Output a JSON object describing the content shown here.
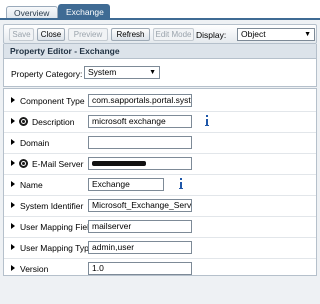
{
  "tabs": [
    {
      "label": "Overview",
      "active": false
    },
    {
      "label": "Exchange",
      "active": true
    }
  ],
  "toolbar": {
    "save_label": "Save",
    "close_label": "Close",
    "preview_label": "Preview",
    "refresh_label": "Refresh",
    "edit_mode_label": "Edit Mode",
    "display_label": "Display:",
    "display_value": "Object"
  },
  "editor": {
    "title": "Property Editor - Exchange",
    "category_label": "Property Category:",
    "category_value": "System"
  },
  "properties": [
    {
      "label": "Component Type",
      "value": "com.sapportals.portal.system",
      "globe": false,
      "info": false
    },
    {
      "label": "Description",
      "value": "microsoft exchange",
      "globe": true,
      "info": true
    },
    {
      "label": "Domain",
      "value": "",
      "globe": false,
      "info": false
    },
    {
      "label": "E-Mail Server",
      "value": "",
      "globe": true,
      "info": false,
      "redacted": true
    },
    {
      "label": "Name",
      "value": "Exchange",
      "globe": false,
      "info": true
    },
    {
      "label": "System Identifier",
      "value": "Microsoft_Exchange_Server",
      "globe": false,
      "info": false
    },
    {
      "label": "User Mapping Fields",
      "value": "mailserver",
      "globe": false,
      "info": false
    },
    {
      "label": "User Mapping Type",
      "value": "admin,user",
      "globe": false,
      "info": false
    },
    {
      "label": "Version",
      "value": "1.0",
      "globe": false,
      "info": false
    }
  ],
  "colors": {
    "accent": "#3f6b94",
    "info_icon": "#1f57a8"
  }
}
